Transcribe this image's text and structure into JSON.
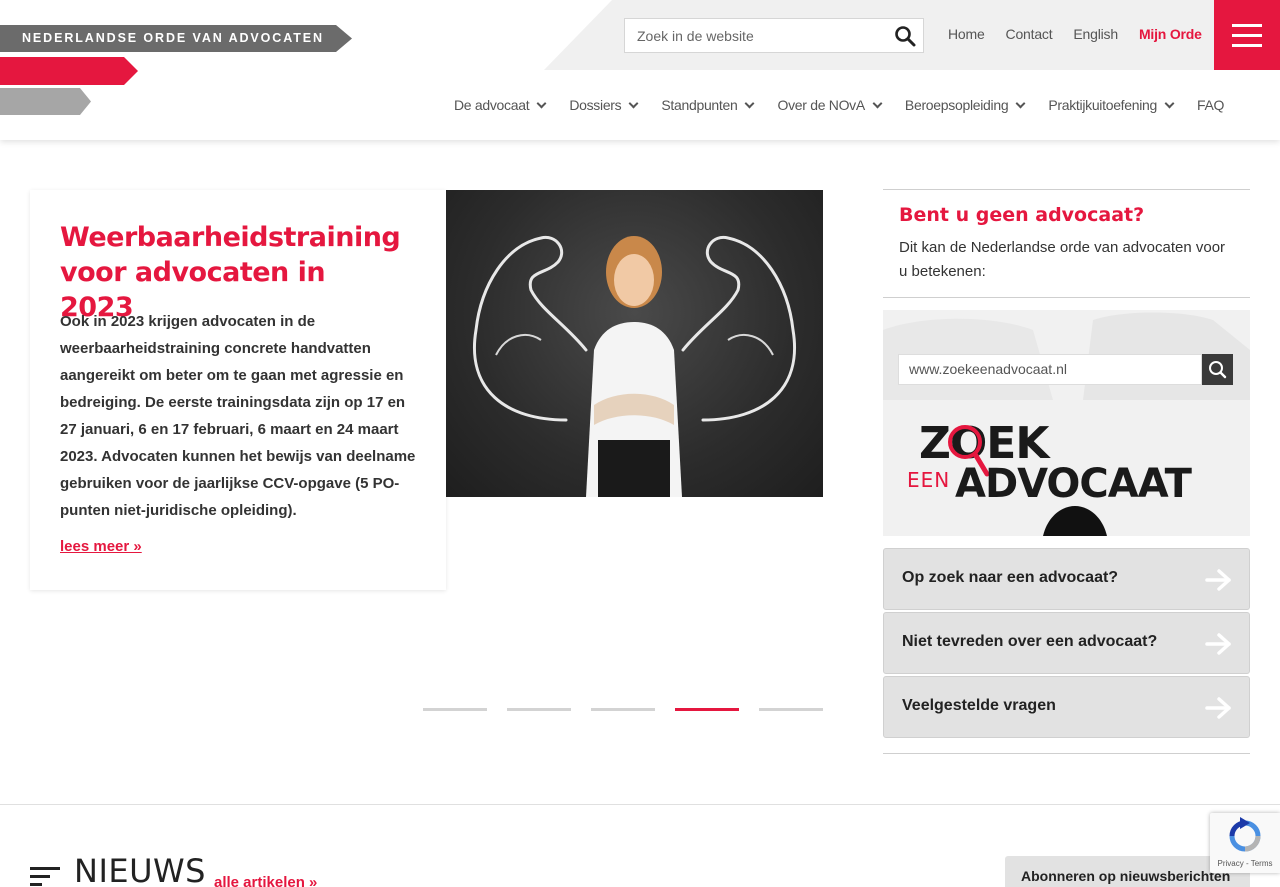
{
  "header": {
    "logo_text": "NEDERLANDSE ORDE VAN ADVOCATEN",
    "search_placeholder": "Zoek in de website",
    "top_links": {
      "home": "Home",
      "contact": "Contact",
      "english": "English",
      "mijn_orde": "Mijn Orde"
    },
    "nav": [
      {
        "label": "De advocaat"
      },
      {
        "label": "Dossiers"
      },
      {
        "label": "Standpunten"
      },
      {
        "label": "Over de NOvA"
      },
      {
        "label": "Beroepsopleiding"
      },
      {
        "label": "Praktijkuitoefening"
      },
      {
        "label": "FAQ"
      }
    ]
  },
  "slider": {
    "title": "Weerbaarheidstraining voor advocaten in 2023",
    "text": "Ook in 2023 krijgen advocaten in de weerbaarheidstraining concrete handvatten aangereikt om beter om te gaan met agressie en bedreiging. De eerste trainingsdata zijn op 17 en 27 januari, 6 en 17 februari, 6 maart en 24 maart 2023. Advocaten kunnen het bewijs van deelname gebruiken voor de jaarlijkse CCV-opgave (5 PO-punten niet-juridische opleiding).",
    "read_more": "lees meer »",
    "dot_count": 5,
    "active_dot": 4
  },
  "sidebar": {
    "title": "Bent u geen advocaat?",
    "text": "Dit kan de Nederlandse orde van advocaten voor u betekenen:",
    "banner": {
      "search_text": "www.zoekeenadvocaat.nl",
      "logo_word1": "ZOEK",
      "logo_word2": "EEN",
      "logo_word3": "ADVOCAAT"
    },
    "buttons": [
      {
        "label": "Op zoek naar een advocaat?"
      },
      {
        "label": "Niet tevreden over een advocaat?"
      },
      {
        "label": "Veelgestelde vragen"
      }
    ]
  },
  "news": {
    "title": "NIEUWS",
    "all_articles": "alle artikelen »",
    "subscribe": "Abonneren op nieuwsberichten"
  },
  "recaptcha": {
    "text": "Privacy - Terms"
  },
  "colors": {
    "brand_red": "#e5173f",
    "logo_gray": "#6b6b6b",
    "button_gray": "#e2e2e2"
  }
}
